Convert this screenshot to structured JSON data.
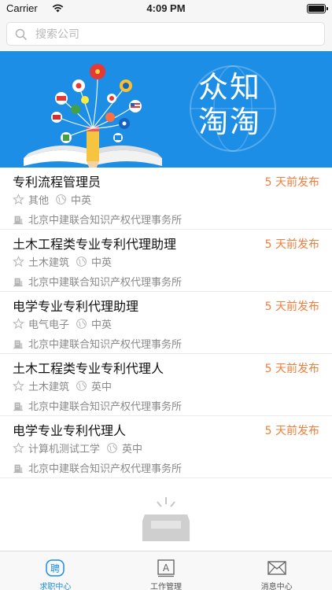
{
  "status_bar": {
    "carrier": "Carrier",
    "time": "4:09 PM"
  },
  "search": {
    "placeholder": "搜索公司",
    "value": ""
  },
  "banner": {
    "title": "众知淘淘"
  },
  "jobs": [
    {
      "title": "专利流程管理员",
      "posted": "5 天前发布",
      "category": "其他",
      "language": "中英",
      "company": "北京中建联合知识产权代理事务所"
    },
    {
      "title": "土木工程类专业专利代理助理",
      "posted": "5 天前发布",
      "category": "土木建筑",
      "language": "中英",
      "company": "北京中建联合知识产权代理事务所"
    },
    {
      "title": "电学专业专利代理助理",
      "posted": "5 天前发布",
      "category": "电气电子",
      "language": "中英",
      "company": "北京中建联合知识产权代理事务所"
    },
    {
      "title": "土木工程类专业专利代理人",
      "posted": "5 天前发布",
      "category": "土木建筑",
      "language": "英中",
      "company": "北京中建联合知识产权代理事务所"
    },
    {
      "title": "电学专业专利代理人",
      "posted": "5 天前发布",
      "category": "计算机测试工学",
      "language": "英中",
      "company": "北京中建联合知识产权代理事务所"
    }
  ],
  "tabs": [
    {
      "label": "求职中心",
      "icon": "job-seek-icon",
      "active": true
    },
    {
      "label": "工作管理",
      "icon": "work-manage-icon",
      "active": false
    },
    {
      "label": "消息中心",
      "icon": "mail-icon",
      "active": false
    }
  ],
  "colors": {
    "accent": "#1d8ee6",
    "posted": "#f07e3c",
    "meta": "#8a8a8a"
  }
}
